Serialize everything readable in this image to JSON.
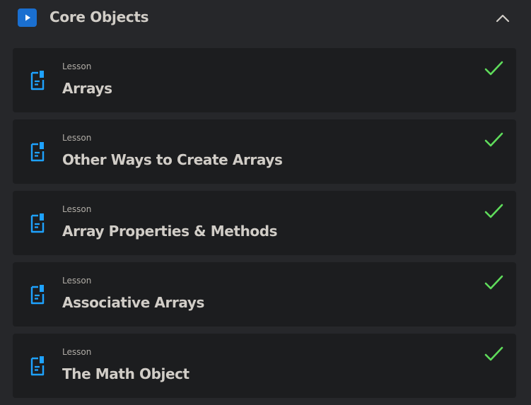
{
  "section": {
    "title": "Core Objects",
    "play_icon": "play-icon",
    "collapse_icon": "chevron-up-icon"
  },
  "colors": {
    "background": "#26272a",
    "card": "#1c1d1f",
    "accent": "#1a6fd0",
    "icon_blue": "#1ea2ff",
    "check_green": "#5fdc5b",
    "text_primary": "#d1cdc7",
    "text_secondary": "#b0aca6"
  },
  "lessons": [
    {
      "kicker": "Lesson",
      "title": "Arrays",
      "icon": "document-icon",
      "status_icon": "checkmark-icon",
      "completed": true
    },
    {
      "kicker": "Lesson",
      "title": "Other Ways to Create Arrays",
      "icon": "document-icon",
      "status_icon": "checkmark-icon",
      "completed": true
    },
    {
      "kicker": "Lesson",
      "title": "Array Properties & Methods",
      "icon": "document-icon",
      "status_icon": "checkmark-icon",
      "completed": true
    },
    {
      "kicker": "Lesson",
      "title": "Associative Arrays",
      "icon": "document-icon",
      "status_icon": "checkmark-icon",
      "completed": true
    },
    {
      "kicker": "Lesson",
      "title": "The Math Object",
      "icon": "document-icon",
      "status_icon": "checkmark-icon",
      "completed": true
    }
  ]
}
